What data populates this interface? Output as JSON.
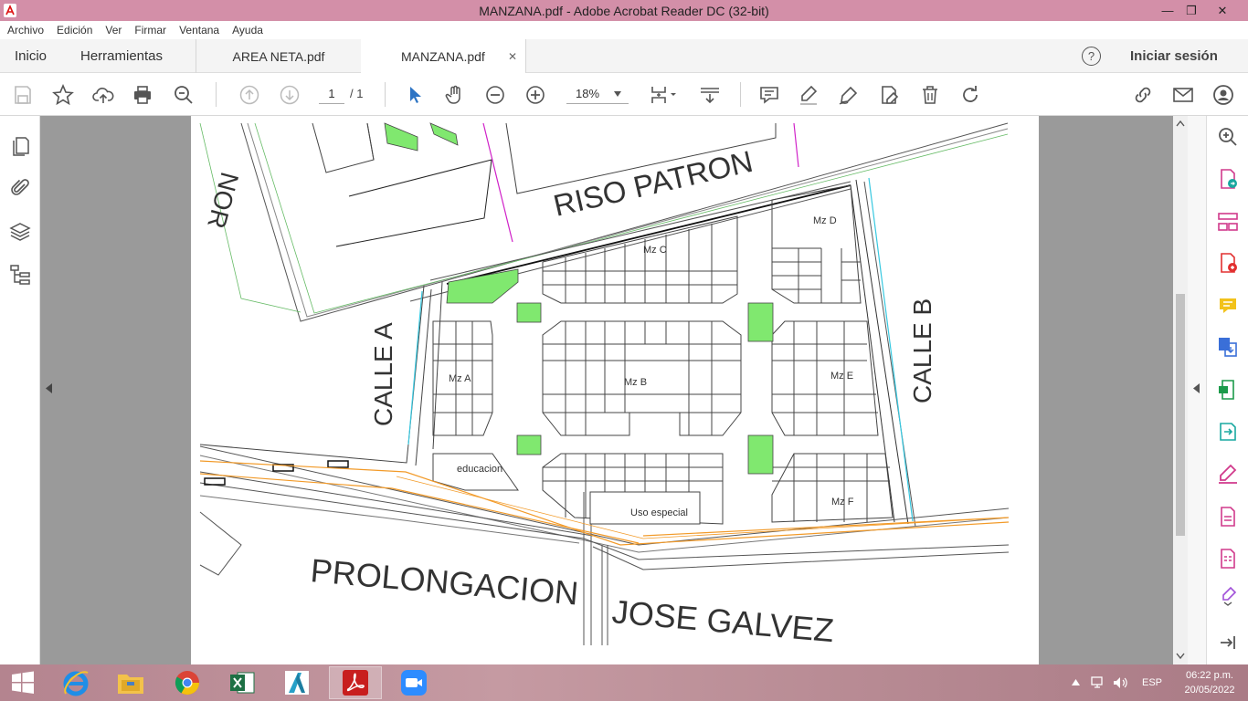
{
  "window": {
    "title": "MANZANA.pdf - Adobe Acrobat Reader DC (32-bit)",
    "minimize": "—",
    "restore": "❐",
    "close": "✕"
  },
  "menu": [
    "Archivo",
    "Edición",
    "Ver",
    "Firmar",
    "Ventana",
    "Ayuda"
  ],
  "tabs": {
    "home": "Inicio",
    "tools": "Herramientas",
    "doc1": "AREA NETA.pdf",
    "doc2": "MANZANA.pdf",
    "close_glyph": "✕",
    "help_glyph": "?",
    "signin": "Iniciar sesión"
  },
  "toolbar": {
    "page_current": "1",
    "page_total": "/ 1",
    "zoom": "18%"
  },
  "drawing": {
    "street_top": "RISO PATRON",
    "street_left": "CALLE A",
    "street_right": "CALLE B",
    "street_bottom_1": "PROLONGACION",
    "street_bottom_2": "JOSE GALVEZ",
    "street_corner": "NOR",
    "blocks": {
      "a": "Mz A",
      "b": "Mz B",
      "c": "Mz C",
      "d": "Mz D",
      "e": "Mz E",
      "f": "Mz F",
      "edu": "educacion",
      "special": "Uso especial"
    },
    "colors": {
      "green_area": "#80e86f",
      "cyan_line": "#38c8e0",
      "magenta_line": "#d020c8",
      "orange_line": "#f29a28"
    }
  },
  "taskbar": {
    "lang": "ESP",
    "time": "06:22 p.m.",
    "date": "20/05/2022"
  }
}
